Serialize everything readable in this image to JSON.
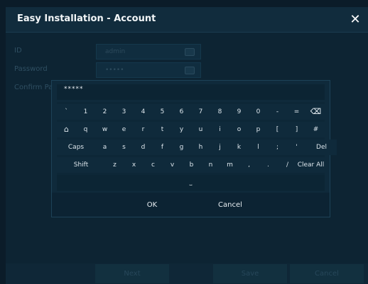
{
  "window": {
    "title": "Easy Installation - Account",
    "close_glyph": "✕"
  },
  "form": {
    "id_label": "ID",
    "id_value": "admin",
    "password_label": "Password",
    "password_value": "•••••",
    "confirm_label": "Confirm Password"
  },
  "keyboard": {
    "input_value": "*****",
    "rows": [
      [
        "`",
        "1",
        "2",
        "3",
        "4",
        "5",
        "6",
        "7",
        "8",
        "9",
        "0",
        "-",
        "=",
        "⌫"
      ],
      [
        "⌂",
        "q",
        "w",
        "e",
        "r",
        "t",
        "y",
        "u",
        "i",
        "o",
        "p",
        "[",
        "]",
        "#"
      ],
      [
        "Caps",
        "a",
        "s",
        "d",
        "f",
        "g",
        "h",
        "j",
        "k",
        "l",
        ";",
        "'",
        "Del"
      ],
      [
        "Shift",
        "z",
        "x",
        "c",
        "v",
        "b",
        "n",
        "m",
        ",",
        ".",
        "/",
        "Clear All"
      ],
      [
        "⎵"
      ]
    ],
    "ok_label": "OK",
    "cancel_label": "Cancel"
  },
  "footer": {
    "next_label": "Next",
    "save_label": "Save",
    "cancel_label": "Cancel"
  }
}
